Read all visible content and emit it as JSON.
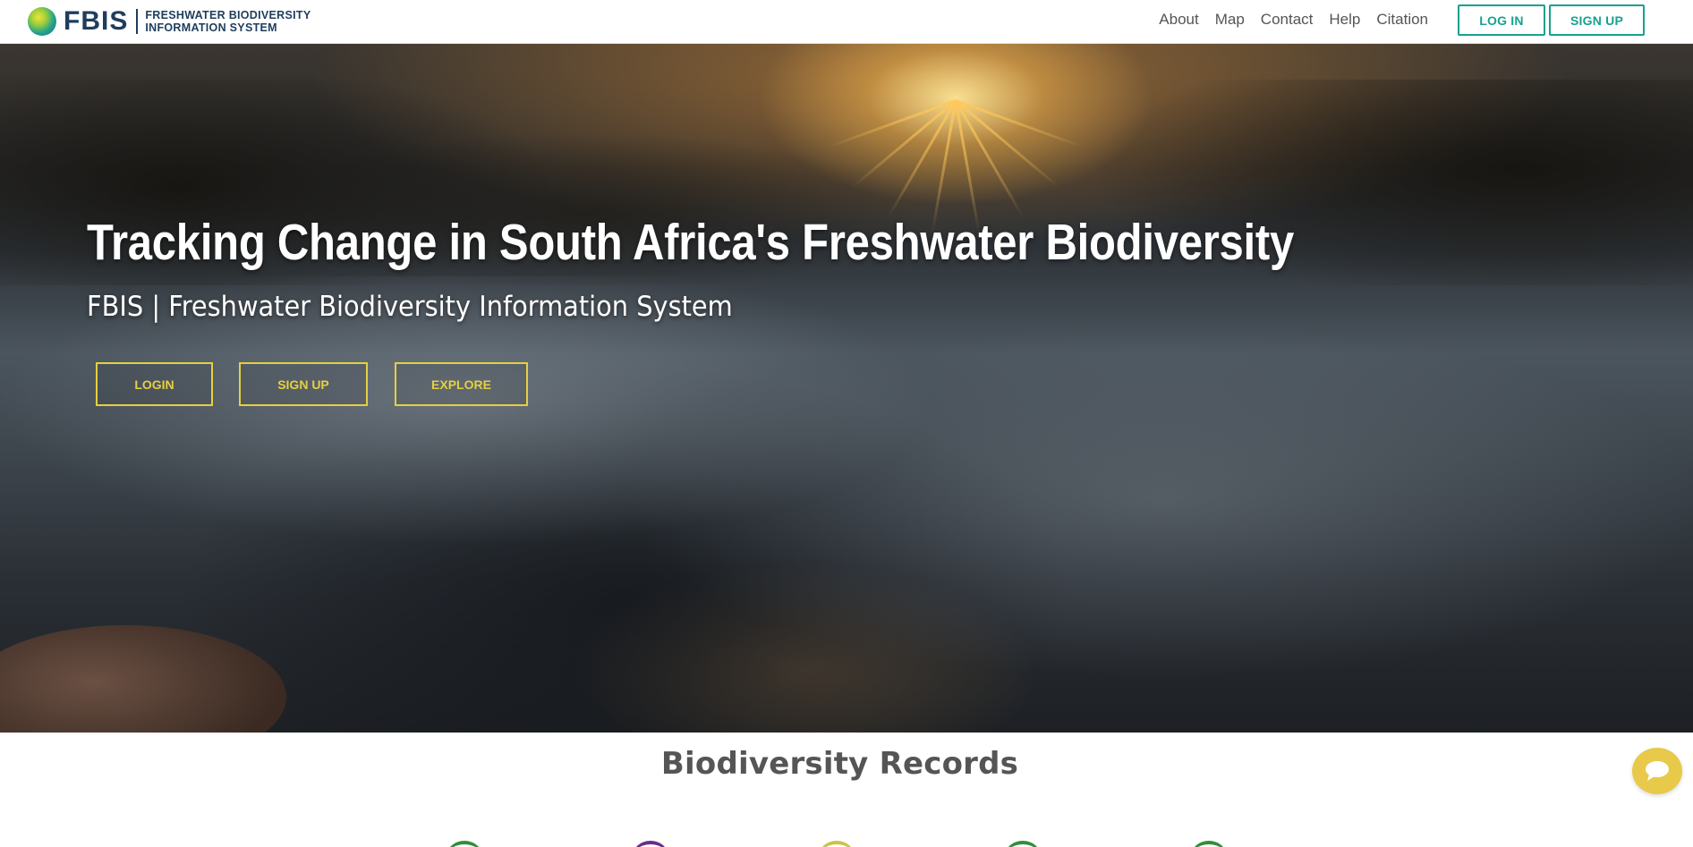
{
  "brand": {
    "acronym": "FBIS",
    "full_name_line1": "FRESHWATER BIODIVERSITY",
    "full_name_line2": "INFORMATION SYSTEM"
  },
  "nav": {
    "links": [
      "About",
      "Map",
      "Contact",
      "Help",
      "Citation"
    ],
    "login_label": "LOG IN",
    "signup_label": "SIGN UP",
    "accent_color": "#18a18f"
  },
  "hero": {
    "title": "Tracking Change in South Africa's Freshwater Biodiversity",
    "subtitle": "FBIS | Freshwater Biodiversity Information System",
    "buttons": {
      "login": "LOGIN",
      "signup": "SIGN UP",
      "explore": "EXPLORE"
    },
    "button_color": "#e6cf42"
  },
  "records": {
    "title": "Biodiversity Records",
    "tile_colors": [
      "#2f8f3a",
      "#6a2c91",
      "#c9c44a",
      "#2f8f3a",
      "#2f8f3a"
    ]
  },
  "chat": {
    "icon": "chat-bubble-icon",
    "color": "#e8c94a"
  }
}
